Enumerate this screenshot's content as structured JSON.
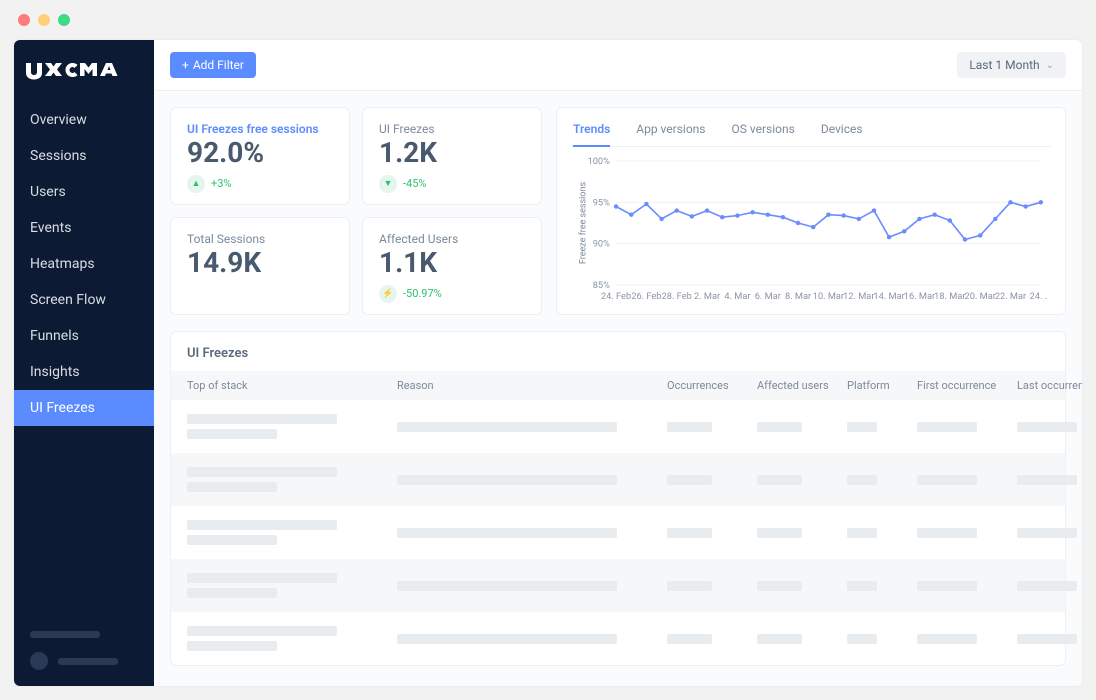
{
  "brand": "uxcam",
  "sidebar": {
    "items": [
      {
        "label": "Overview"
      },
      {
        "label": "Sessions"
      },
      {
        "label": "Users"
      },
      {
        "label": "Events"
      },
      {
        "label": "Heatmaps"
      },
      {
        "label": "Screen Flow"
      },
      {
        "label": "Funnels"
      },
      {
        "label": "Insights"
      },
      {
        "label": "UI Freezes",
        "active": true
      }
    ]
  },
  "topbar": {
    "add_filter": "Add Filter",
    "date_range": "Last 1 Month"
  },
  "metrics": {
    "freeze_free": {
      "label": "UI Freezes free sessions",
      "value": "92.0%",
      "delta": "+3%",
      "direction": "up"
    },
    "freezes": {
      "label": "UI Freezes",
      "value": "1.2K",
      "delta": "-45%",
      "direction": "down"
    },
    "total_sessions": {
      "label": "Total Sessions",
      "value": "14.9K"
    },
    "affected_users": {
      "label": "Affected Users",
      "value": "1.1K",
      "delta": "-50.97%"
    }
  },
  "chart": {
    "tabs": [
      "Trends",
      "App versions",
      "OS versions",
      "Devices"
    ],
    "active_tab": "Trends"
  },
  "chart_data": {
    "type": "line",
    "title": "",
    "xlabel": "",
    "ylabel": "Freeze free sessions",
    "ylim": [
      85,
      100
    ],
    "yticks": [
      85,
      90,
      95,
      100
    ],
    "categories": [
      "24. Feb",
      "26. Feb",
      "28. Feb",
      "2. Mar",
      "4. Mar",
      "6. Mar",
      "8. Mar",
      "10. Mar",
      "12. Mar",
      "14. Mar",
      "16. Mar",
      "18. Mar",
      "20. Mar",
      "22. Mar",
      "24. ..."
    ],
    "values": [
      94.5,
      93.5,
      94.8,
      93.0,
      94.0,
      93.3,
      94.0,
      93.2,
      93.4,
      93.8,
      93.5,
      93.2,
      92.5,
      92.0,
      93.5,
      93.4,
      93.0,
      94.0,
      90.8,
      91.5,
      93.0,
      93.5,
      92.8,
      90.5,
      91.0,
      93.0,
      95.0,
      94.5,
      95.0
    ]
  },
  "table": {
    "title": "UI Freezes",
    "columns": [
      "Top of stack",
      "Reason",
      "Occurrences",
      "Affected users",
      "Platform",
      "First occurrence",
      "Last occurrence"
    ]
  }
}
